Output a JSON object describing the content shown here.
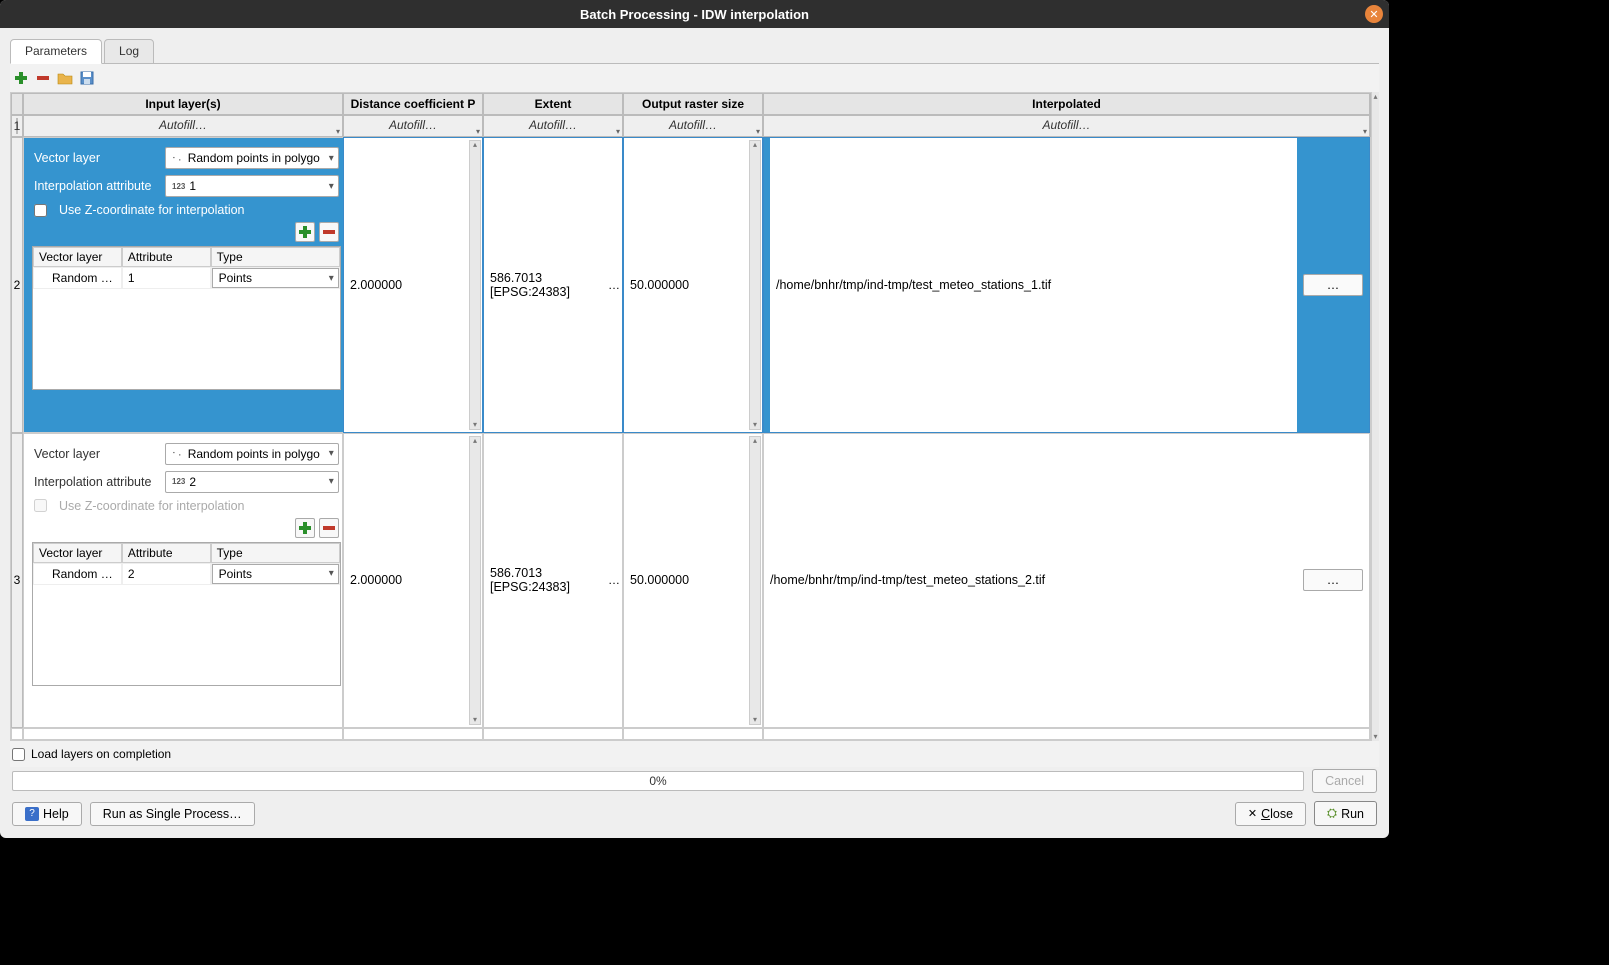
{
  "window": {
    "title": "Batch Processing - IDW interpolation"
  },
  "tabs": {
    "parameters": "Parameters",
    "log": "Log"
  },
  "toolbar": {
    "add": "add-row",
    "remove": "remove-row",
    "open": "open",
    "save": "save"
  },
  "columns": {
    "row": "",
    "input": "Input layer(s)",
    "distance": "Distance coefficient P",
    "extent": "Extent",
    "size": "Output raster size",
    "interp": "Interpolated"
  },
  "autofill": "Autofill…",
  "rownums": {
    "r1": "1",
    "r2": "2",
    "r3": "3"
  },
  "panel_labels": {
    "vector_layer": "Vector layer",
    "interp_attr": "Interpolation attribute",
    "use_z": "Use Z-coordinate for interpolation",
    "sub_vector": "Vector layer",
    "sub_attr": "Attribute",
    "sub_type": "Type"
  },
  "row2": {
    "vector_combo": "Random points in polygo",
    "attr_combo_prefix": "123",
    "attr_combo": "1",
    "sub_vector": "Random …",
    "sub_attr": "1",
    "sub_type": "Points",
    "distance": "2.000000",
    "extent": "586.7013 [EPSG:24383]",
    "extent_ellip": "…",
    "size": "50.000000",
    "interp": "/home/bnhr/tmp/ind-tmp/test_meteo_stations_1.tif",
    "browse": "…"
  },
  "row3": {
    "vector_combo": "Random points in polygo",
    "attr_combo_prefix": "123",
    "attr_combo": "2",
    "sub_vector": "Random …",
    "sub_attr": "2",
    "sub_type": "Points",
    "distance": "2.000000",
    "extent": "586.7013 [EPSG:24383]",
    "extent_ellip": "…",
    "size": "50.000000",
    "interp": "/home/bnhr/tmp/ind-tmp/test_meteo_stations_2.tif",
    "browse": "…"
  },
  "load_layers": "Load layers on completion",
  "progress": "0%",
  "buttons": {
    "cancel": "Cancel",
    "help": "Help",
    "run_single": "Run as Single Process…",
    "close": "Close",
    "run": "Run",
    "help_icon": "?",
    "close_x": "✕",
    "run_icon": "✔"
  }
}
